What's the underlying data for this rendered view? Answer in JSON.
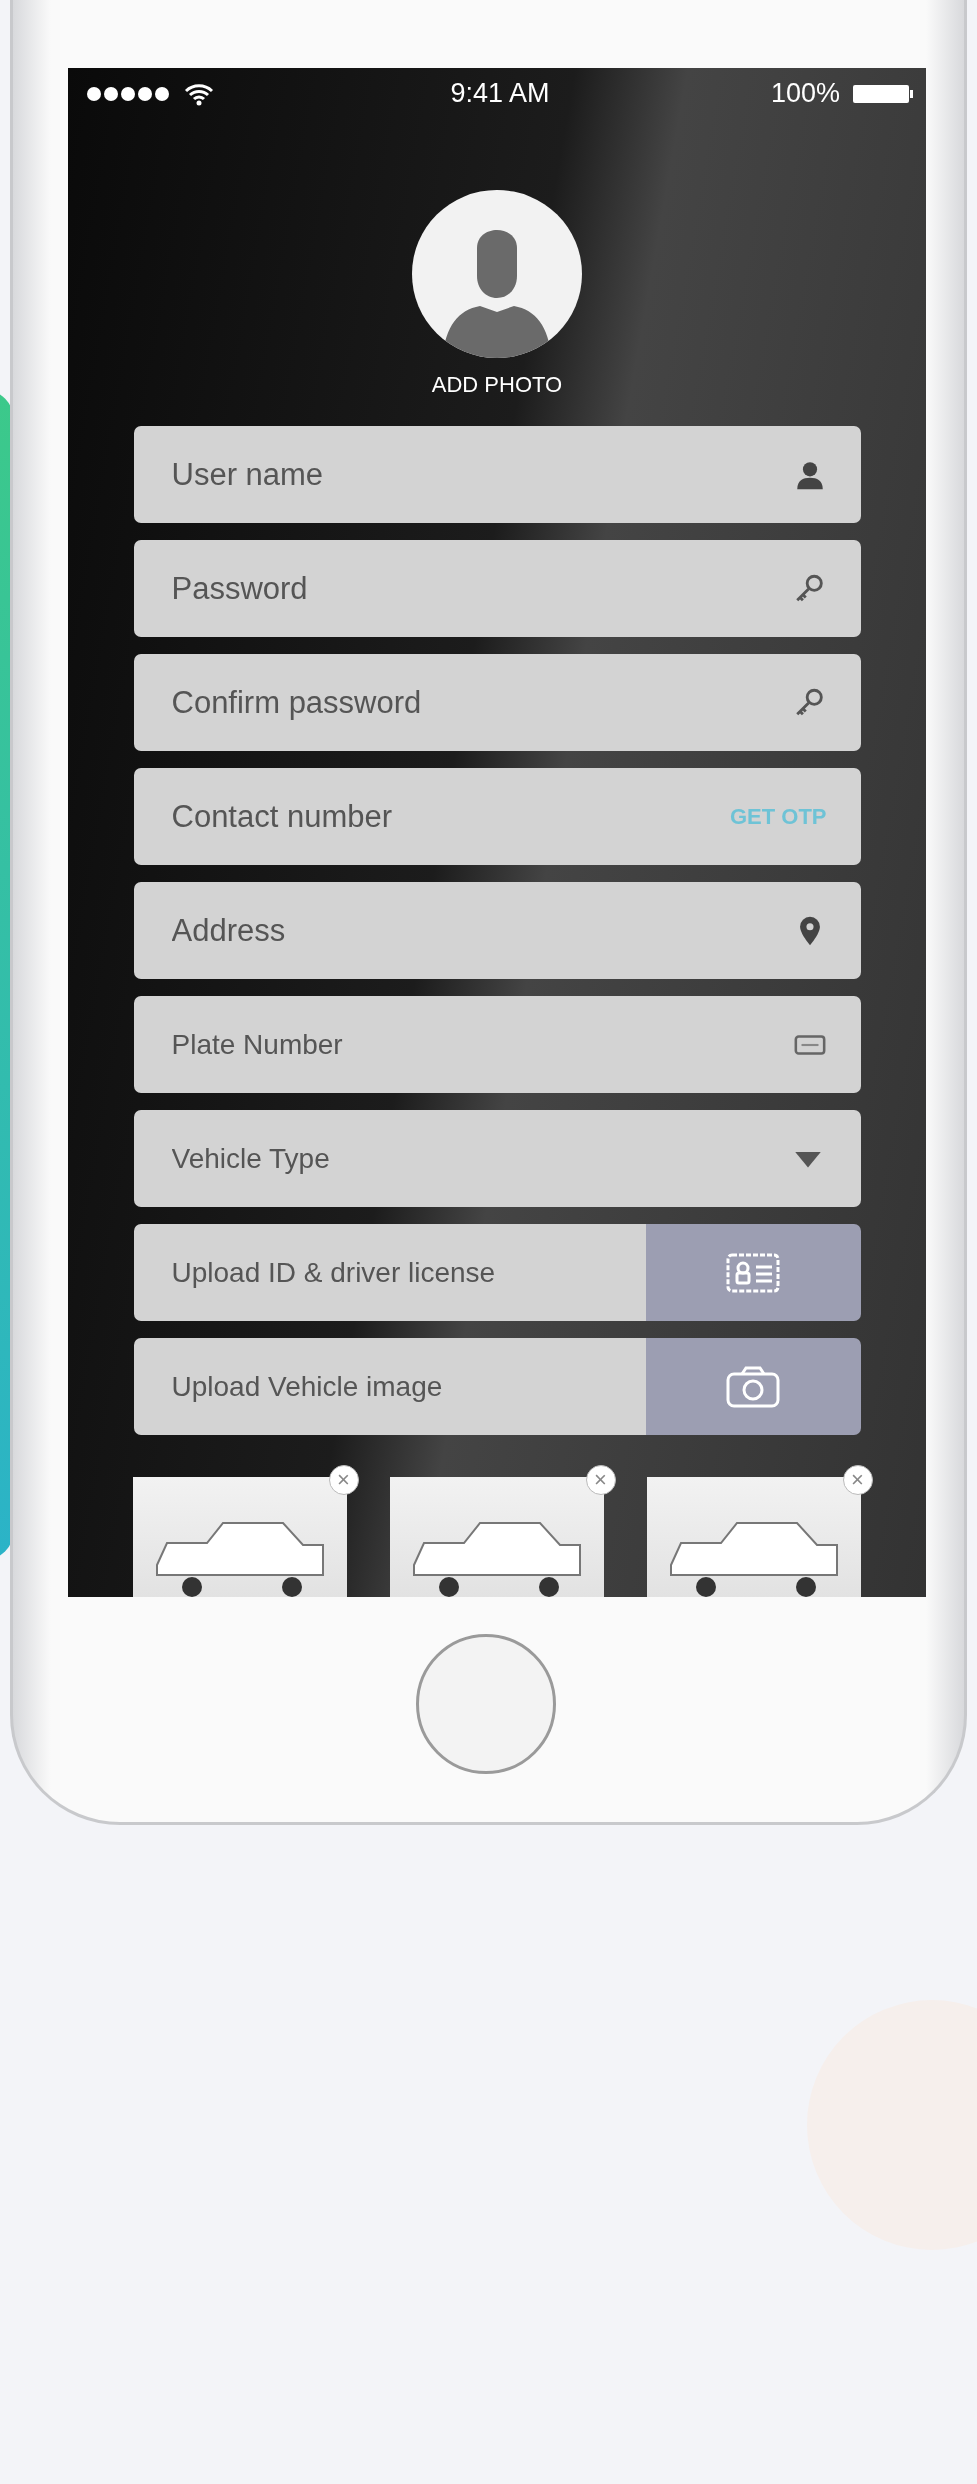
{
  "status_bar": {
    "time": "9:41 AM",
    "battery": "100%"
  },
  "avatar": {
    "label": "ADD PHOTO"
  },
  "fields": [
    {
      "kind": "input",
      "placeholder": "User name"
    },
    {
      "kind": "input",
      "placeholder": "Password"
    },
    {
      "kind": "input",
      "placeholder": "Confirm password"
    },
    {
      "kind": "otp",
      "placeholder": "Contact number",
      "action": "GET OTP"
    },
    {
      "kind": "input",
      "placeholder": "Address"
    },
    {
      "kind": "input",
      "placeholder": "Plate Number"
    },
    {
      "kind": "select",
      "placeholder": "Vehicle Type"
    },
    {
      "kind": "upload",
      "placeholder": "Upload ID & driver license"
    },
    {
      "kind": "upload",
      "placeholder": "Upload Vehicle image"
    }
  ],
  "vehicle_images": [
    {
      "remove": "×"
    },
    {
      "remove": "×"
    },
    {
      "remove": "×"
    }
  ]
}
